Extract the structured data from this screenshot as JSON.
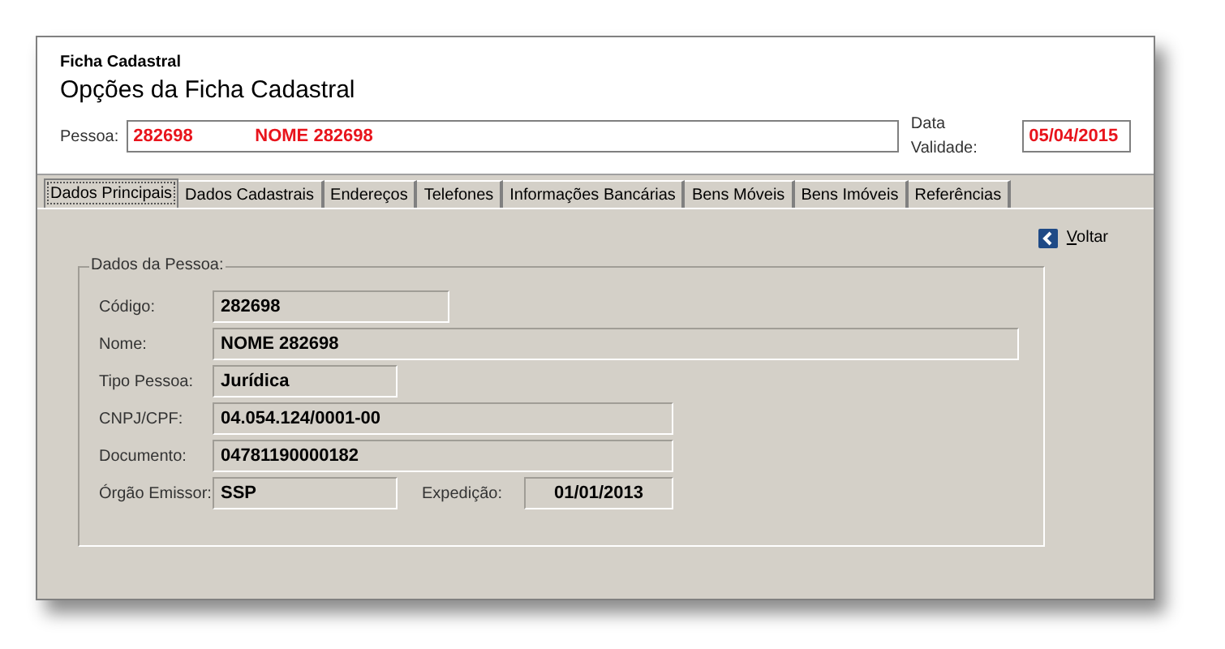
{
  "header": {
    "subtitle": "Ficha Cadastral",
    "title": "Opções da Ficha Cadastral",
    "person_label": "Pessoa:",
    "person_code": "282698",
    "person_name": "NOME 282698",
    "validity_label": "Data Validade:",
    "validity_value": "05/04/2015"
  },
  "tabs": [
    {
      "label": "Dados Principais",
      "selected": true
    },
    {
      "label": "Dados Cadastrais",
      "selected": false
    },
    {
      "label": "Endereços",
      "selected": false
    },
    {
      "label": "Telefones",
      "selected": false
    },
    {
      "label": "Informações Bancárias",
      "selected": false
    },
    {
      "label": "Bens Móveis",
      "selected": false
    },
    {
      "label": "Bens Imóveis",
      "selected": false
    },
    {
      "label": "Referências",
      "selected": false
    }
  ],
  "back_link": "Voltar",
  "group": {
    "title": "Dados da Pessoa:",
    "fields": [
      {
        "label": "Código:",
        "value": "282698"
      },
      {
        "label": "Nome:",
        "value": "NOME 282698"
      },
      {
        "label": "Tipo Pessoa:",
        "value": "Jurídica"
      },
      {
        "label": "CNPJ/CPF:",
        "value": "04.054.124/0001-00"
      },
      {
        "label": "Documento:",
        "value": "04781190000182"
      },
      {
        "label": "Órgão Emissor:",
        "value": "SSP",
        "extra_label": "Expedição:",
        "extra_value": "01/01/2013"
      }
    ]
  }
}
